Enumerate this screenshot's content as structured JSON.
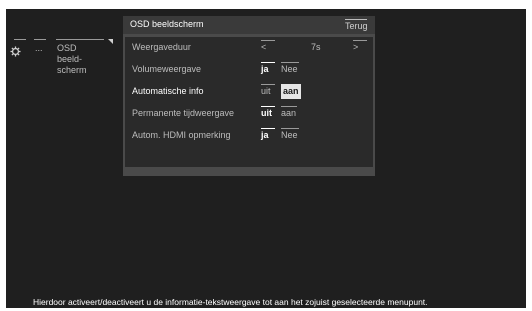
{
  "breadcrumb": {
    "icon": "gear-icon",
    "dots": "...",
    "label": "OSD beeld-\nscherm"
  },
  "panel": {
    "title": "OSD beeldscherm",
    "back_label": "Terug",
    "rows": [
      {
        "label": "Weergaveduur",
        "options": [
          "<",
          "7s",
          ">"
        ]
      },
      {
        "label": "Volumeweergave",
        "options": [
          "ja",
          "Nee"
        ],
        "selected": "ja"
      },
      {
        "label": "Automatische info",
        "options": [
          "uit",
          "aan"
        ],
        "selected": "aan",
        "focused": true
      },
      {
        "label": "Permanente tijdweergave",
        "options": [
          "uit",
          "aan"
        ],
        "selected": "uit"
      },
      {
        "label": "Autom. HDMI opmerking",
        "options": [
          "ja",
          "Nee"
        ],
        "selected": "ja"
      }
    ]
  },
  "footer": {
    "help_text": "Hierdoor activeert/deactiveert u de informatie-tekstweergave tot aan het zojuist geselecteerde menupunt."
  }
}
